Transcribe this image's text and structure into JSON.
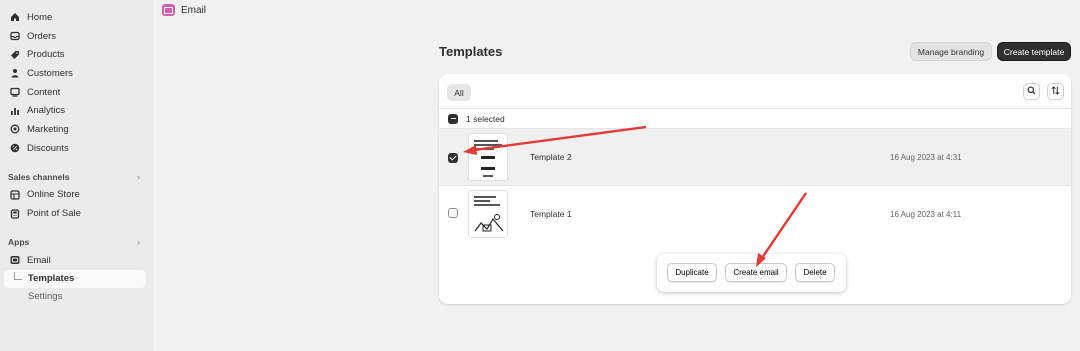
{
  "sidebar": {
    "items": [
      {
        "label": "Home",
        "icon": "home-icon"
      },
      {
        "label": "Orders",
        "icon": "orders-icon"
      },
      {
        "label": "Products",
        "icon": "tag-icon"
      },
      {
        "label": "Customers",
        "icon": "person-icon"
      },
      {
        "label": "Content",
        "icon": "content-icon"
      },
      {
        "label": "Analytics",
        "icon": "bar-chart-icon"
      },
      {
        "label": "Marketing",
        "icon": "target-icon"
      },
      {
        "label": "Discounts",
        "icon": "discount-icon"
      }
    ],
    "sales_channels": {
      "heading": "Sales channels",
      "items": [
        {
          "label": "Online Store",
          "icon": "store-icon"
        },
        {
          "label": "Point of Sale",
          "icon": "pos-icon"
        }
      ]
    },
    "apps": {
      "heading": "Apps",
      "app": {
        "label": "Email",
        "icon": "email-app-icon"
      },
      "subitems": [
        {
          "label": "Templates",
          "active": true
        },
        {
          "label": "Settings",
          "active": false
        }
      ]
    },
    "chevron": "›"
  },
  "topbar": {
    "app_name": "Email",
    "app_color": "#d65eb2"
  },
  "page": {
    "title": "Templates",
    "manage_branding_label": "Manage branding",
    "create_template_label": "Create template"
  },
  "table": {
    "filter_tab": "All",
    "selection_text": "1 selected",
    "rows": [
      {
        "name": "Template 2",
        "date": "16 Aug 2023 at 4:31",
        "checked": true
      },
      {
        "name": "Template 1",
        "date": "16 Aug 2023 at 4:11",
        "checked": false
      }
    ]
  },
  "bulk_actions": {
    "duplicate": "Duplicate",
    "create_email": "Create email",
    "delete": "Delete"
  },
  "colors": {
    "annotation_arrow": "#e53935",
    "primary_button": "#303030"
  }
}
